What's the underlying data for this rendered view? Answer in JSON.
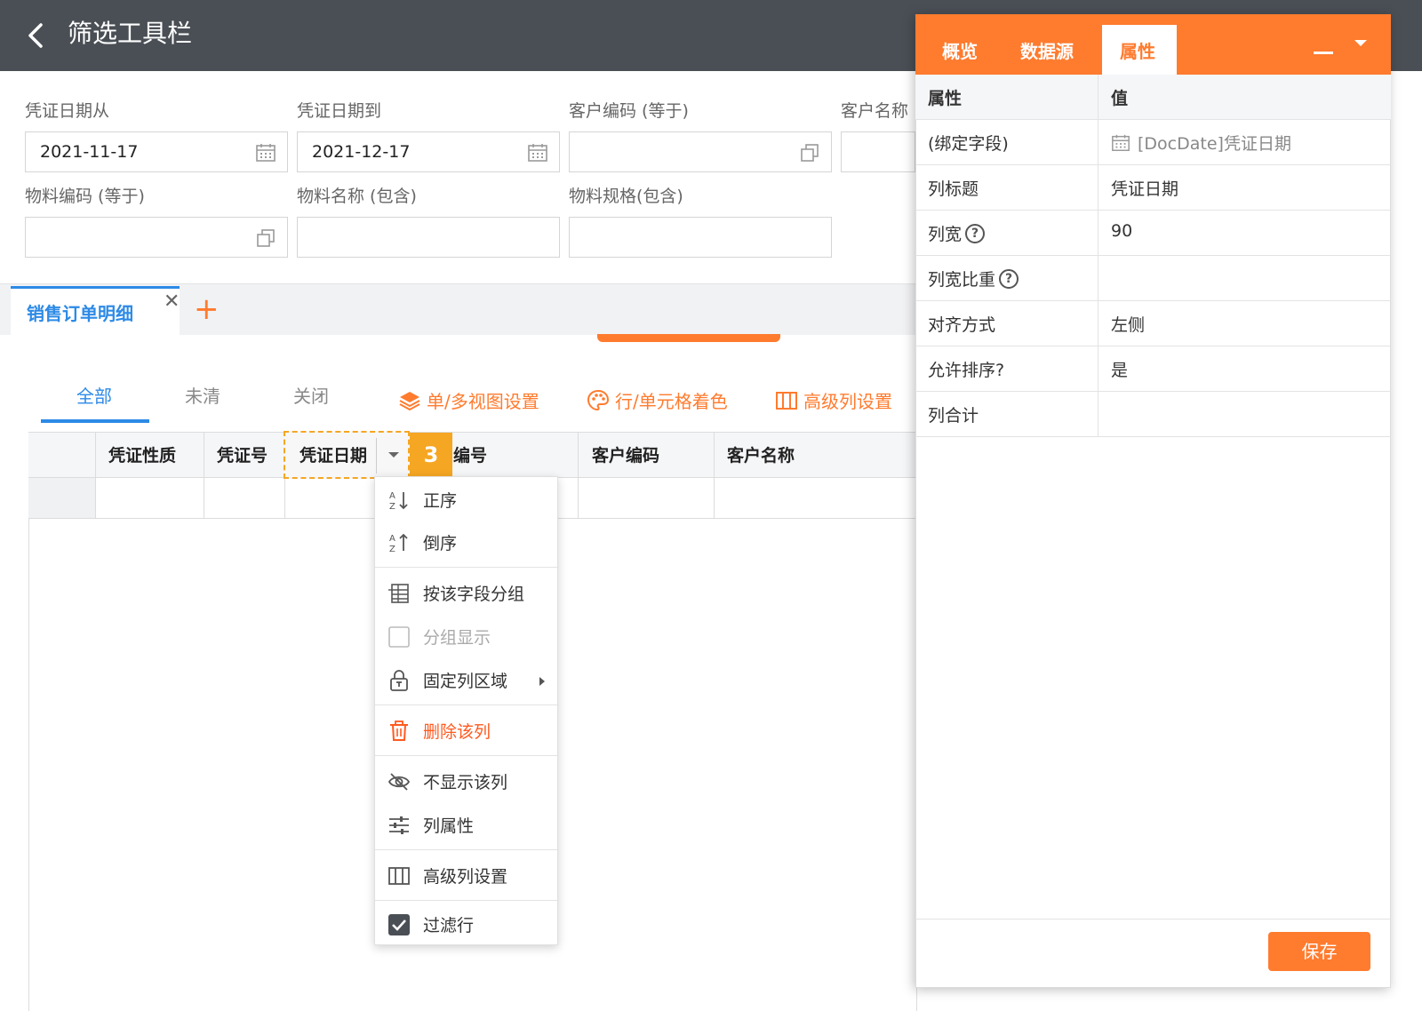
{
  "header": {
    "title": "筛选工具栏"
  },
  "filters": {
    "voucher_date_from": {
      "label": "凭证日期从",
      "value": "2021-11-17"
    },
    "voucher_date_to": {
      "label": "凭证日期到",
      "value": "2021-12-17"
    },
    "customer_code": {
      "label": "客户编码 (等于)",
      "value": ""
    },
    "customer_name": {
      "label": "客户名称",
      "value": ""
    },
    "material_code": {
      "label": "物料编码 (等于)",
      "value": ""
    },
    "material_name": {
      "label": "物料名称 (包含)",
      "value": ""
    },
    "material_spec": {
      "label": "物料规格(包含)",
      "value": ""
    }
  },
  "tabs": {
    "active": "销售订单明细"
  },
  "subtabs": [
    "全部",
    "未清",
    "关闭"
  ],
  "toolbar": {
    "view_settings": "单/多视图设置",
    "cell_coloring": "行/单元格着色",
    "advanced_columns": "高级列设置"
  },
  "grid": {
    "columns": [
      "凭证性质",
      "凭证号",
      "凭证日期",
      "编号",
      "客户编码",
      "客户名称"
    ],
    "step_badge": "3"
  },
  "context_menu": {
    "sort_asc": "正序",
    "sort_desc": "倒序",
    "group_by": "按该字段分组",
    "group_display": "分组显示",
    "freeze": "固定列区域",
    "delete": "删除该列",
    "hide": "不显示该列",
    "properties": "列属性",
    "advanced": "高级列设置",
    "filter_row": "过滤行"
  },
  "panel": {
    "tabs": [
      "概览",
      "数据源",
      "属性"
    ],
    "active_tab": "属性",
    "header_key": "属性",
    "header_value": "值",
    "rows": [
      {
        "key": "(绑定字段)",
        "value": "[DocDate]凭证日期"
      },
      {
        "key": "列标题",
        "value": "凭证日期"
      },
      {
        "key": "列宽",
        "value": "90"
      },
      {
        "key": "列宽比重",
        "value": ""
      },
      {
        "key": "对齐方式",
        "value": "左侧"
      },
      {
        "key": "允许排序?",
        "value": "是"
      },
      {
        "key": "列合计",
        "value": ""
      }
    ],
    "help_icon": "?",
    "save": "保存"
  },
  "colors": {
    "accent": "#ff7b2e",
    "primary": "#2d8ae6",
    "highlight": "#f5a623",
    "header_bg": "#4a4f55"
  }
}
